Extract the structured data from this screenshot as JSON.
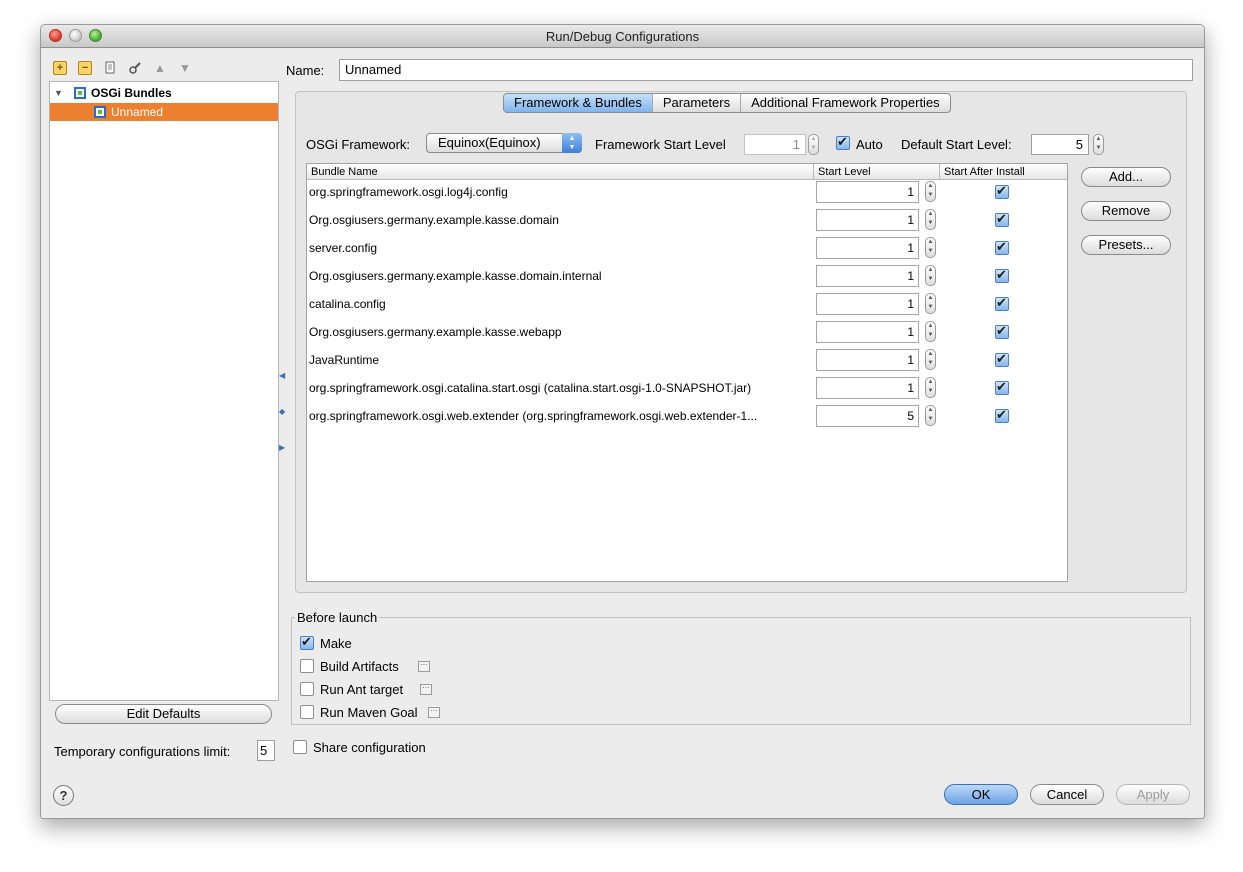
{
  "window": {
    "title": "Run/Debug Configurations"
  },
  "toolbar": {
    "add_icon": "add-config-icon",
    "remove_icon": "remove-config-icon",
    "copy_icon": "copy-config-icon",
    "settings_icon": "wrench-icon",
    "up_icon": "arrow-up-icon",
    "down_icon": "arrow-down-icon"
  },
  "tree": {
    "root": {
      "label": "OSGi Bundles",
      "icon": "osgi-icon"
    },
    "children": [
      {
        "label": "Unnamed",
        "selected": true,
        "icon": "osgi-icon"
      }
    ]
  },
  "left_panel": {
    "edit_defaults_label": "Edit Defaults",
    "temp_limit_label": "Temporary configurations limit:",
    "temp_limit_value": "5"
  },
  "name_field": {
    "label": "Name:",
    "value": "Unnamed"
  },
  "tabs": [
    {
      "label": "Framework & Bundles",
      "active": true
    },
    {
      "label": "Parameters",
      "active": false
    },
    {
      "label": "Additional Framework Properties",
      "active": false
    }
  ],
  "framework": {
    "osgi_label": "OSGi Framework:",
    "osgi_value": "Equinox(Equinox)",
    "start_level_label": "Framework Start Level",
    "start_level_value": "1",
    "auto_label": "Auto",
    "auto_checked": true,
    "default_start_level_label": "Default Start Level:",
    "default_start_level_value": "5"
  },
  "table": {
    "columns": [
      "Bundle Name",
      "Start Level",
      "Start After Install"
    ],
    "rows": [
      {
        "name": "org.springframework.osgi.log4j.config",
        "level": "1",
        "start": true
      },
      {
        "name": "Org.osgiusers.germany.example.kasse.domain",
        "level": "1",
        "start": true
      },
      {
        "name": "server.config",
        "level": "1",
        "start": true
      },
      {
        "name": "Org.osgiusers.germany.example.kasse.domain.internal",
        "level": "1",
        "start": true
      },
      {
        "name": "catalina.config",
        "level": "1",
        "start": true
      },
      {
        "name": "Org.osgiusers.germany.example.kasse.webapp",
        "level": "1",
        "start": true
      },
      {
        "name": "JavaRuntime",
        "level": "1",
        "start": true
      },
      {
        "name": "org.springframework.osgi.catalina.start.osgi (catalina.start.osgi-1.0-SNAPSHOT.jar)",
        "level": "1",
        "start": true
      },
      {
        "name": "org.springframework.osgi.web.extender (org.springframework.osgi.web.extender-1...",
        "level": "5",
        "start": true
      }
    ]
  },
  "side_buttons": {
    "add": "Add...",
    "remove": "Remove",
    "presets": "Presets..."
  },
  "before_launch": {
    "title": "Before launch",
    "items": [
      {
        "label": "Make",
        "checked": true,
        "has_options": false
      },
      {
        "label": "Build Artifacts",
        "checked": false,
        "has_options": true
      },
      {
        "label": "Run Ant target",
        "checked": false,
        "has_options": true
      },
      {
        "label": "Run Maven Goal",
        "checked": false,
        "has_options": true
      }
    ]
  },
  "share": {
    "label": "Share configuration",
    "checked": false
  },
  "footer": {
    "help": "?",
    "ok": "OK",
    "cancel": "Cancel",
    "apply": "Apply"
  },
  "colors": {
    "selection": "#ed7f31",
    "accent": "#6ea3e6"
  }
}
